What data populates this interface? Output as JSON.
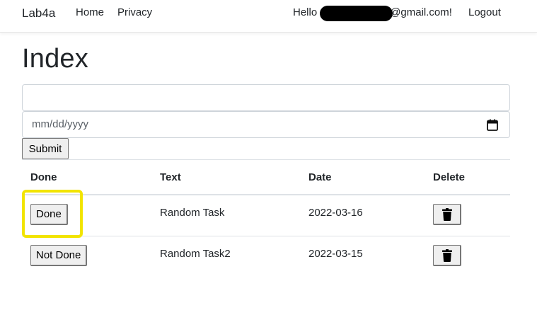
{
  "navbar": {
    "brand": "Lab4a",
    "links": [
      "Home",
      "Privacy"
    ],
    "greeting": "Hello",
    "email_suffix": "@gmail.com!",
    "logout": "Logout"
  },
  "page": {
    "title": "Index"
  },
  "form": {
    "text_value": "",
    "date_placeholder": "mm/dd/yyyy",
    "submit_label": "Submit"
  },
  "table": {
    "headers": [
      "Done",
      "Text",
      "Date",
      "Delete"
    ],
    "rows": [
      {
        "status_label": "Done",
        "text": "Random Task",
        "date": "2022-03-16"
      },
      {
        "status_label": "Not Done",
        "text": "Random Task2",
        "date": "2022-03-15"
      }
    ]
  },
  "annotation": {
    "highlight_color": "#f2e400",
    "icons": [
      "calendar-icon",
      "trash-icon"
    ]
  }
}
